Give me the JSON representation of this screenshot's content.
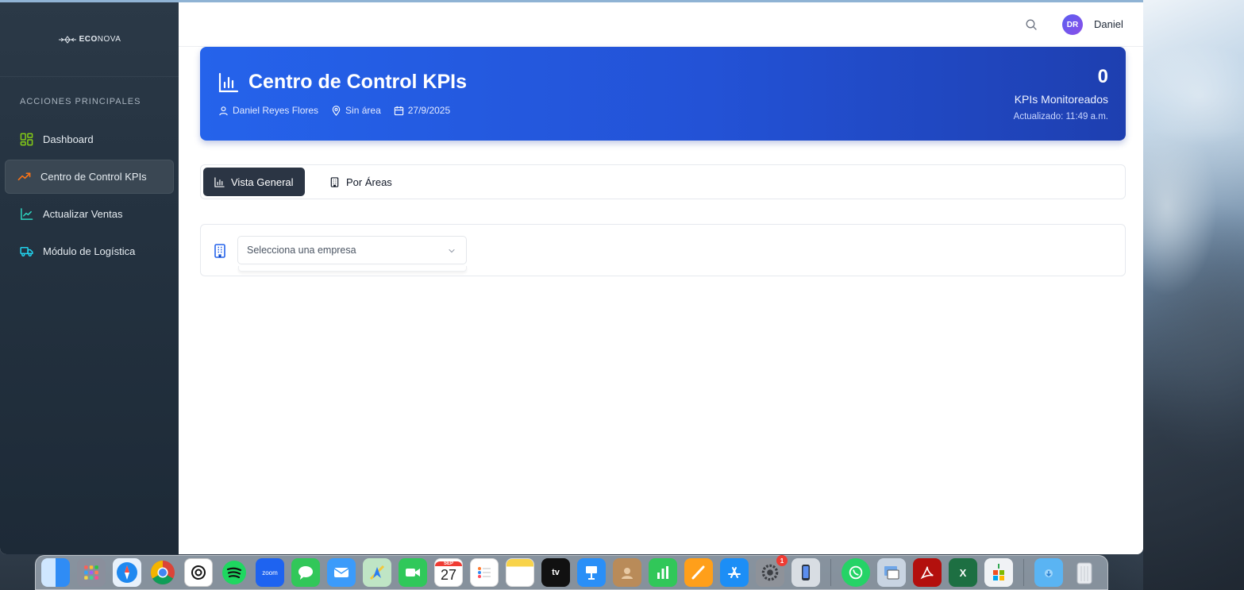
{
  "sidebar": {
    "logo_prefix": "ECO",
    "logo_suffix": "NOVA",
    "section_title": "ACCIONES PRINCIPALES",
    "items": [
      {
        "label": "Dashboard",
        "icon": "grid-icon"
      },
      {
        "label": "Centro de Control KPIs",
        "icon": "trending-up-icon",
        "active": true
      },
      {
        "label": "Actualizar Ventas",
        "icon": "line-chart-icon"
      },
      {
        "label": "Módulo de Logística",
        "icon": "truck-icon"
      }
    ]
  },
  "topbar": {
    "avatar_initials": "DR",
    "username": "Daniel"
  },
  "hero": {
    "title": "Centro de Control KPIs",
    "user": "Daniel Reyes Flores",
    "area": "Sin área",
    "date": "27/9/2025",
    "kpi_count": "0",
    "kpi_label": "KPIs Monitoreados",
    "updated": "Actualizado: 11:49 a.m."
  },
  "tabs": [
    {
      "label": "Vista General",
      "active": true
    },
    {
      "label": "Por Áreas",
      "active": false
    }
  ],
  "filter": {
    "company_select_placeholder": "Selecciona una empresa"
  },
  "dock": {
    "calendar_month": "SEP",
    "calendar_day": "27",
    "zoom_label": "zoom",
    "tv_label": "tv",
    "settings_badge": "1",
    "excel_label": "X"
  },
  "colors": {
    "hero_gradient_start": "#2563eb",
    "hero_gradient_end": "#1e3fb0",
    "sidebar_bg": "#243240",
    "active_tab_bg": "#2b3544",
    "accent_green": "#84cc16",
    "accent_orange": "#f97316",
    "accent_cyan": "#22d3ee"
  }
}
